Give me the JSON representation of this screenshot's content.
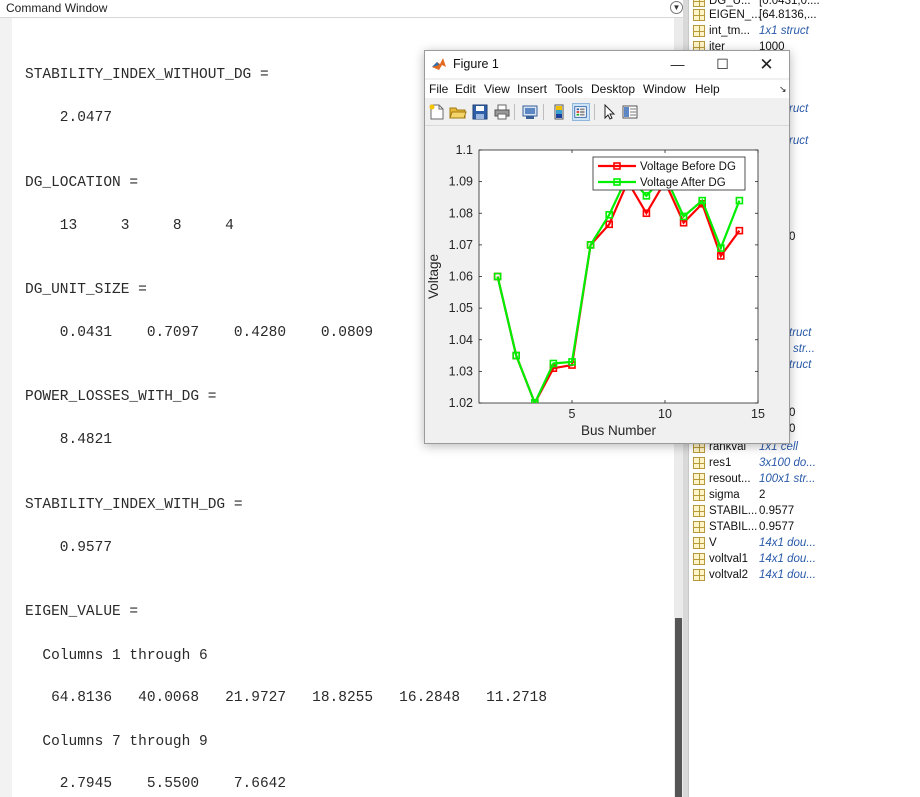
{
  "command_window": {
    "title": "Command Window",
    "lines": [
      "STABILITY_INDEX_WITHOUT_DG =",
      "    2.0477",
      "DG_LOCATION =",
      "    13     3     8     4",
      "DG_UNIT_SIZE =",
      "    0.0431    0.7097    0.4280    0.0809",
      "POWER_LOSSES_WITH_DG =",
      "    8.4821",
      "STABILITY_INDEX_WITH_DG =",
      "    0.9577",
      "EIGEN_VALUE =",
      "  Columns 1 through 6",
      "   64.8136   40.0068   21.9727   18.8255   16.2848   11.2718",
      "  Columns 7 through 9",
      "    2.7945    5.5500    7.6642"
    ]
  },
  "workspace": {
    "rows_top": [
      {
        "name": "DG_U...",
        "value": "[0.0431,0....",
        "italic": false
      },
      {
        "name": "EIGEN_...",
        "value": "[64.8136,...",
        "italic": false
      },
      {
        "name": "int_tm...",
        "value": "1x1 struct",
        "italic": true
      },
      {
        "name": "iter",
        "value": "1000",
        "italic": false
      }
    ],
    "partials": [
      "ruct",
      "ruct",
      "0",
      "truct",
      "str...",
      "truct",
      "0",
      "0"
    ],
    "rows_bottom": [
      {
        "name": "rankval",
        "value": "1x1 cell",
        "italic": true
      },
      {
        "name": "res1",
        "value": "3x100 do...",
        "italic": true
      },
      {
        "name": "resout...",
        "value": "100x1 str...",
        "italic": true
      },
      {
        "name": "sigma",
        "value": "2",
        "italic": false
      },
      {
        "name": "STABIL...",
        "value": "0.9577",
        "italic": false
      },
      {
        "name": "STABIL...",
        "value": "0.9577",
        "italic": false
      },
      {
        "name": "V",
        "value": "14x1 dou...",
        "italic": true
      },
      {
        "name": "voltval1",
        "value": "14x1 dou...",
        "italic": true
      },
      {
        "name": "voltval2",
        "value": "14x1 dou...",
        "italic": true
      }
    ]
  },
  "figure": {
    "title": "Figure 1",
    "menu": [
      "File",
      "Edit",
      "View",
      "Insert",
      "Tools",
      "Desktop",
      "Window",
      "Help"
    ],
    "toolbar_icons": [
      "new-figure-icon",
      "open-file-icon",
      "save-icon",
      "print-icon",
      "link-icon",
      "colorbar-icon",
      "legend-icon",
      "pointer-icon",
      "property-editor-icon"
    ]
  },
  "chart_data": {
    "type": "line",
    "xlabel": "Bus Number",
    "ylabel": "Voltage",
    "xlim": [
      0,
      15
    ],
    "ylim": [
      1.02,
      1.1
    ],
    "xticks": [
      5,
      10,
      15
    ],
    "yticks": [
      1.02,
      1.03,
      1.04,
      1.05,
      1.06,
      1.07,
      1.08,
      1.09,
      1.1
    ],
    "legend_position": "top-right",
    "grid": false,
    "x": [
      1,
      2,
      3,
      4,
      5,
      6,
      7,
      8,
      9,
      10,
      11,
      12,
      13,
      14
    ],
    "series": [
      {
        "name": "Voltage Before DG",
        "color": "#ff0000",
        "values": [
          1.06,
          1.035,
          1.02,
          1.031,
          1.032,
          1.07,
          1.0765,
          1.09,
          1.08,
          1.09,
          1.077,
          1.083,
          1.0665,
          1.0745
        ]
      },
      {
        "name": "Voltage After DG",
        "color": "#00ee00",
        "values": [
          1.06,
          1.035,
          1.02,
          1.0325,
          1.033,
          1.07,
          1.0795,
          1.092,
          1.0855,
          1.092,
          1.079,
          1.084,
          1.069,
          1.084
        ]
      }
    ]
  }
}
